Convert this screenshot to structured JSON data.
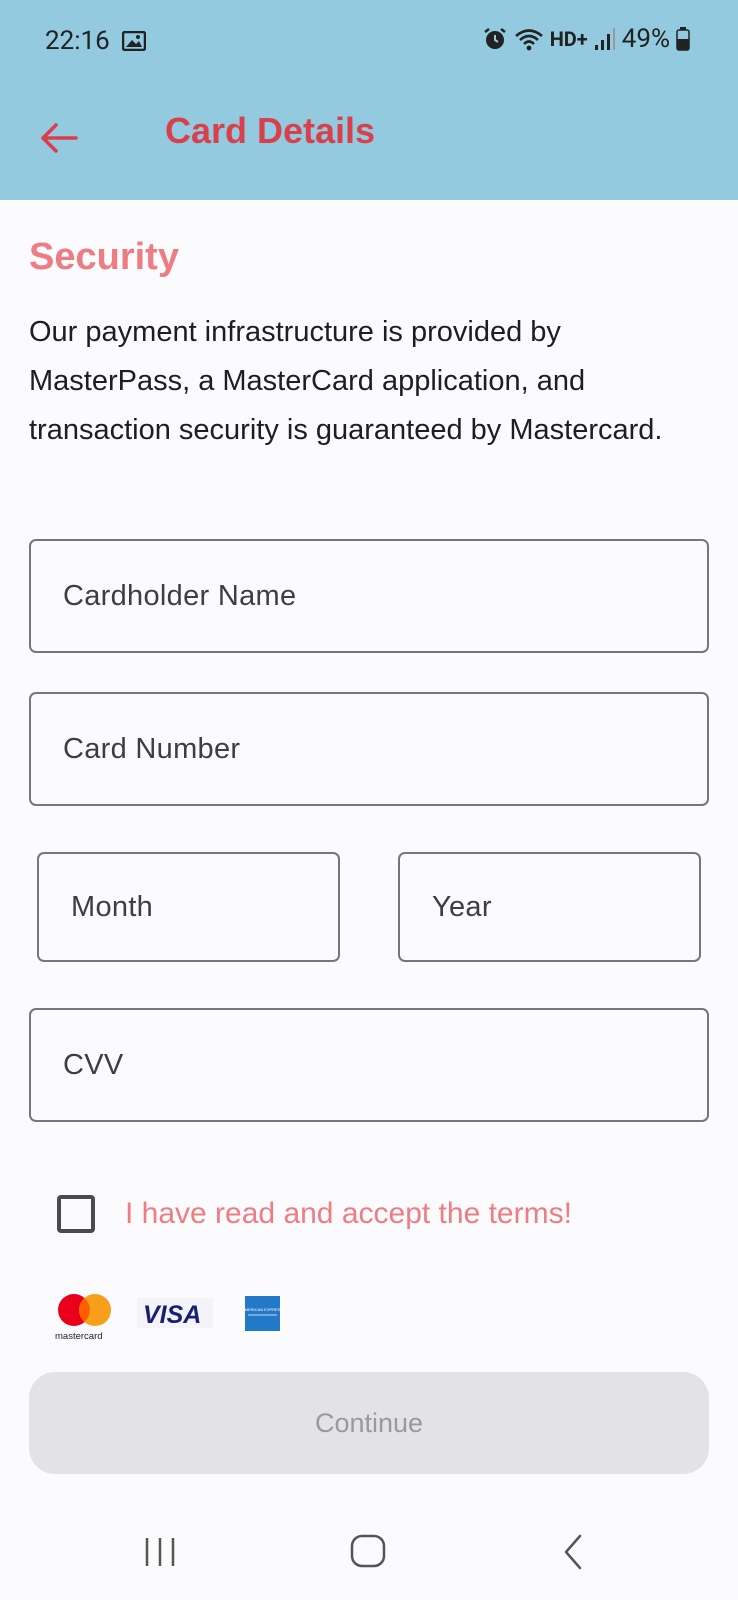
{
  "status": {
    "time": "22:16",
    "battery": "49%",
    "network": "HD+"
  },
  "appbar": {
    "title": "Card Details"
  },
  "security": {
    "title": "Security",
    "description": "Our payment infrastructure is provided by MasterPass, a MasterCard application, and transaction security is guaranteed by Mastercard."
  },
  "form": {
    "cardholder_placeholder": "Cardholder Name",
    "card_number_placeholder": "Card Number",
    "month_placeholder": "Month",
    "year_placeholder": "Year",
    "cvv_placeholder": "CVV",
    "terms_label": "I have read and accept the terms!",
    "terms_checked": false
  },
  "logos": {
    "mastercard": "mastercard",
    "visa": "VISA",
    "amex": "AMERICAN EXPRESS"
  },
  "continue_label": "Continue",
  "icons": {
    "back": "arrow-left-icon",
    "alarm": "alarm-icon",
    "wifi": "wifi-icon",
    "signal": "signal-icon",
    "battery": "battery-icon",
    "gallery": "image-notification-icon"
  },
  "colors": {
    "header_bg": "#93cadf",
    "title_red": "#d9404b",
    "accent_pink": "#ee7d83",
    "button_disabled_bg": "#e3e3e7"
  }
}
